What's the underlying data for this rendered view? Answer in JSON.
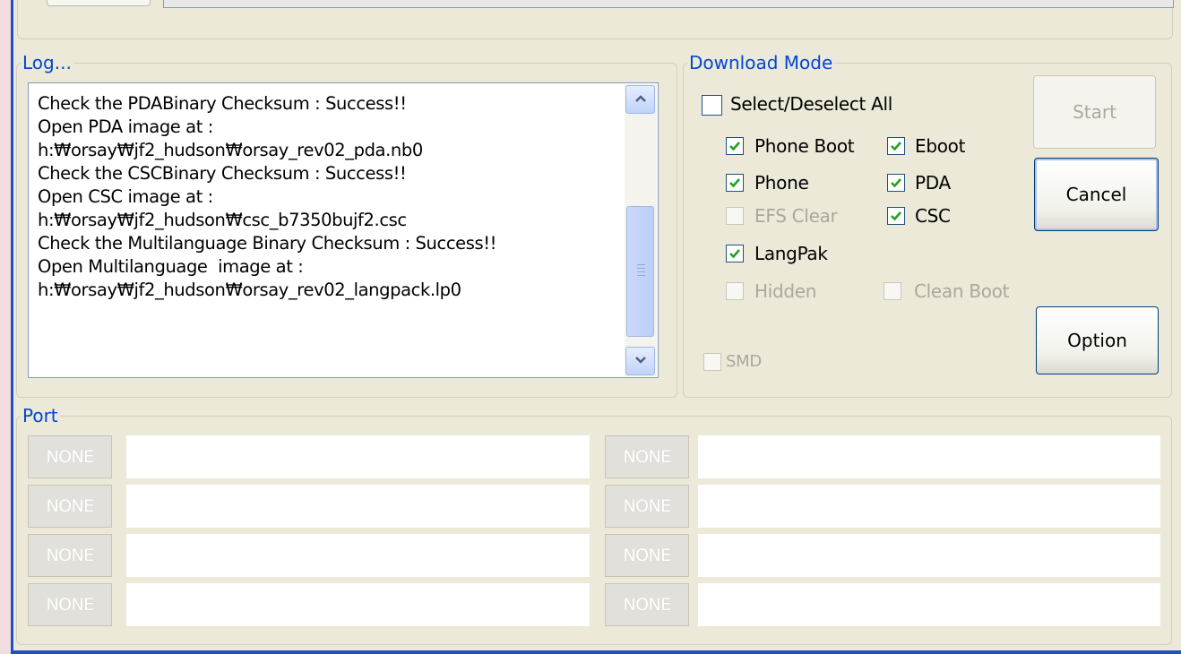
{
  "log": {
    "legend": "Log...",
    "lines": [
      "Check the PDABinary Checksum : Success!!",
      "Open PDA image at :",
      "h:₩orsay₩jf2_hudson₩orsay_rev02_pda.nb0",
      "Check the CSCBinary Checksum : Success!!",
      "Open CSC image at :",
      "h:₩orsay₩jf2_hudson₩csc_b7350bujf2.csc",
      "Check the Multilanguage Binary Checksum : Success!!",
      "Open Multilanguage  image at :",
      "h:₩orsay₩jf2_hudson₩orsay_rev02_langpack.lp0"
    ]
  },
  "download_mode": {
    "legend": "Download Mode",
    "select_all": {
      "label": "Select/Deselect All",
      "checked": false
    },
    "phone_boot": {
      "label": "Phone Boot",
      "checked": true
    },
    "eboot": {
      "label": "Eboot",
      "checked": true
    },
    "phone": {
      "label": "Phone",
      "checked": true
    },
    "pda": {
      "label": "PDA",
      "checked": true
    },
    "efs_clear": {
      "label": "EFS Clear",
      "checked": false,
      "disabled": true
    },
    "csc": {
      "label": "CSC",
      "checked": true
    },
    "langpak": {
      "label": "LangPak",
      "checked": true
    },
    "hidden": {
      "label": "Hidden",
      "checked": false,
      "disabled": true
    },
    "clean_boot": {
      "label": "Clean Boot",
      "checked": false,
      "disabled": true
    },
    "smd": {
      "label": "SMD",
      "checked": false,
      "disabled": true
    }
  },
  "buttons": {
    "start": "Start",
    "cancel": "Cancel",
    "option": "Option"
  },
  "port": {
    "legend": "Port",
    "left": [
      "NONE",
      "NONE",
      "NONE",
      "NONE"
    ],
    "right": [
      "NONE",
      "NONE",
      "NONE",
      "NONE"
    ]
  },
  "colors": {
    "legend": "#0046d5",
    "window_bg": "#ece9d8",
    "checkmark": "#21a121",
    "window_border": "#1f4fc4"
  },
  "icons": {
    "scroll_up": "chevron-up-icon",
    "scroll_down": "chevron-down-icon",
    "check": "checkmark-icon"
  }
}
